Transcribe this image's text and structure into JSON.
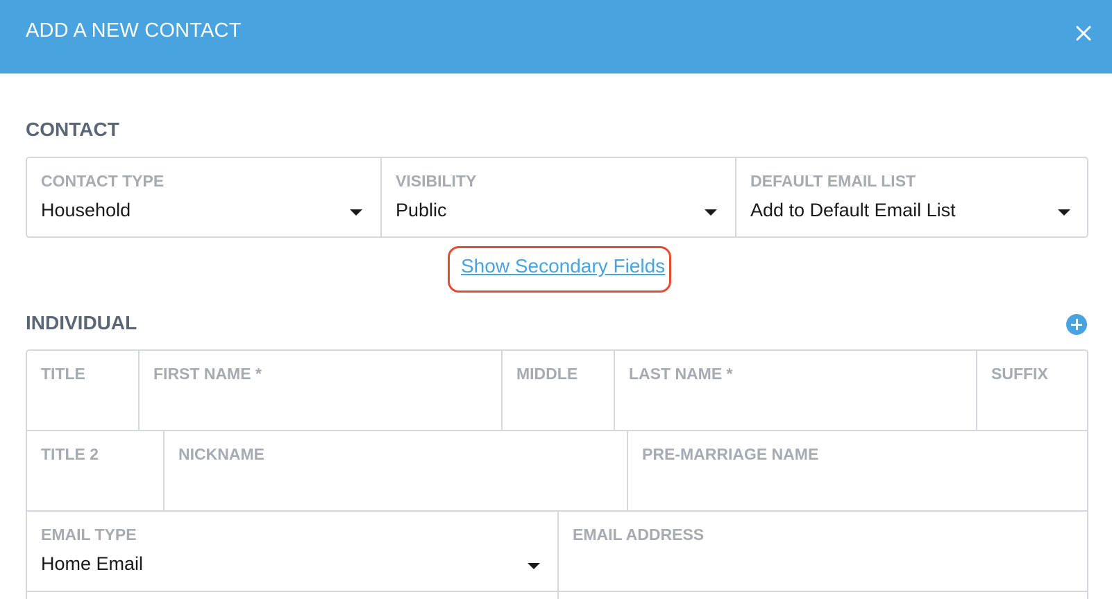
{
  "header": {
    "title": "ADD A NEW CONTACT"
  },
  "contact_section": {
    "title": "CONTACT",
    "fields": [
      {
        "label": "CONTACT TYPE",
        "value": "Household"
      },
      {
        "label": "VISIBILITY",
        "value": "Public"
      },
      {
        "label": "DEFAULT EMAIL LIST",
        "value": "Add to Default Email List"
      }
    ],
    "secondary_link": "Show Secondary Fields"
  },
  "individual_section": {
    "title": "INDIVIDUAL",
    "row1": [
      {
        "label": "TITLE"
      },
      {
        "label": "FIRST NAME *"
      },
      {
        "label": "MIDDLE"
      },
      {
        "label": "LAST NAME *"
      },
      {
        "label": "SUFFIX"
      }
    ],
    "row2": [
      {
        "label": "TITLE 2"
      },
      {
        "label": "NICKNAME"
      },
      {
        "label": "PRE-MARRIAGE NAME"
      }
    ],
    "row3": [
      {
        "label": "EMAIL TYPE",
        "value": "Home Email"
      },
      {
        "label": "EMAIL ADDRESS"
      }
    ]
  },
  "colors": {
    "header_bg": "#48a3de",
    "link": "#48a3de",
    "highlight": "#e54a32"
  }
}
